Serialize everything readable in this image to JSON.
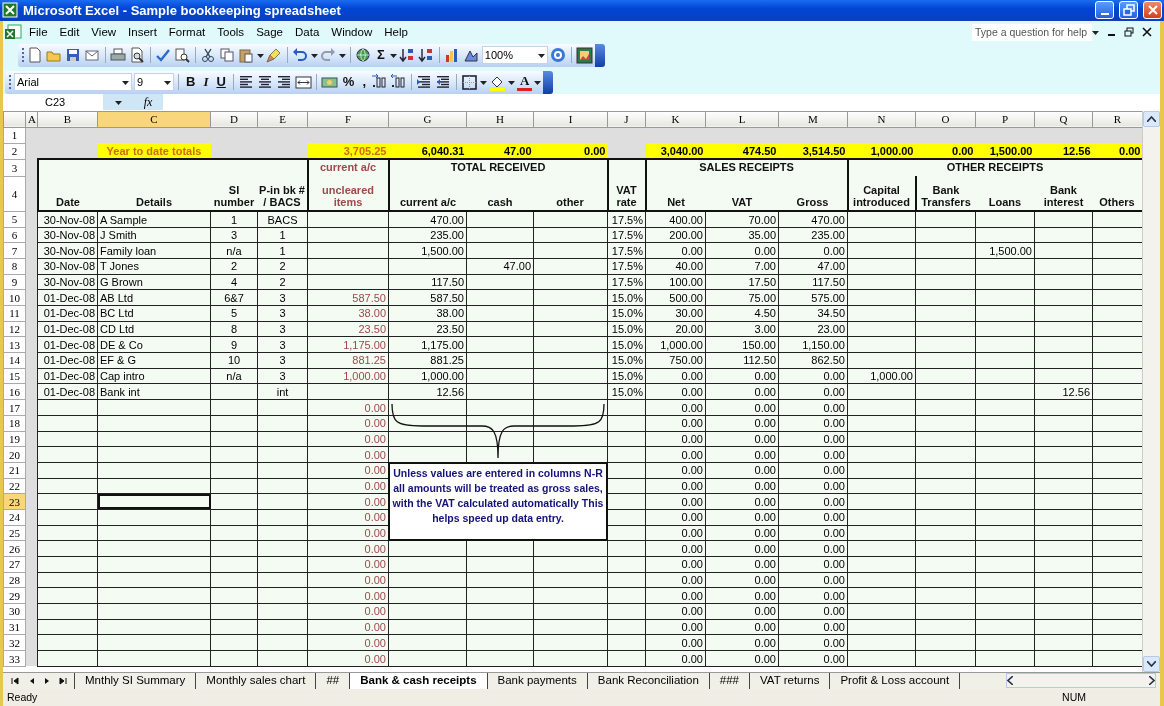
{
  "window": {
    "title": "Microsoft Excel - Sample bookkeeping spreadsheet"
  },
  "menu": [
    "File",
    "Edit",
    "View",
    "Insert",
    "Format",
    "Tools",
    "Sage",
    "Data",
    "Window",
    "Help"
  ],
  "help_search": {
    "placeholder": "Type a question for help"
  },
  "standard_toolbar": {
    "autosum": "Σ",
    "zoom": "100%"
  },
  "formatting_toolbar": {
    "font": "Arial",
    "size": "9",
    "bold": "B",
    "italic": "I",
    "underline": "U",
    "percent": "%",
    "comma": ",",
    "font_color": "A"
  },
  "formula_bar": {
    "name_box": "C23",
    "function_label": "fx"
  },
  "columns": [
    {
      "letter": "A",
      "selected": false
    },
    {
      "letter": "B",
      "selected": false
    },
    {
      "letter": "C",
      "selected": true
    },
    {
      "letter": "D",
      "selected": false
    },
    {
      "letter": "E",
      "selected": false
    },
    {
      "letter": "F",
      "selected": false
    },
    {
      "letter": "G",
      "selected": false
    },
    {
      "letter": "H",
      "selected": false
    },
    {
      "letter": "I",
      "selected": false
    },
    {
      "letter": "J",
      "selected": false
    },
    {
      "letter": "K",
      "selected": false
    },
    {
      "letter": "L",
      "selected": false
    },
    {
      "letter": "M",
      "selected": false
    },
    {
      "letter": "N",
      "selected": false
    },
    {
      "letter": "O",
      "selected": false
    },
    {
      "letter": "P",
      "selected": false
    },
    {
      "letter": "Q",
      "selected": false
    },
    {
      "letter": "R",
      "selected": false
    }
  ],
  "rows": [
    {
      "number": "1",
      "kind": "spacer",
      "selected": false,
      "cells": []
    },
    {
      "number": "2",
      "kind": "totals",
      "selected": false,
      "cells": [
        null,
        null,
        "Year to date totals",
        null,
        null,
        "3,705.25",
        "6,040.31",
        "47.00",
        "0.00",
        null,
        "3,040.00",
        "474.50",
        "3,514.50",
        "1,000.00",
        "0.00",
        "1,500.00",
        "12.56",
        "0.00"
      ]
    },
    {
      "number": "3",
      "kind": "group_header",
      "selected": false,
      "cells": [
        null,
        null,
        null,
        null,
        null,
        "current a/c",
        "TOTAL RECEIVED",
        null,
        null,
        null,
        "SALES RECEIPTS",
        null,
        null,
        "OTHER RECEIPTS",
        null,
        null,
        null,
        null
      ]
    },
    {
      "number": "4",
      "kind": "column_header",
      "selected": false,
      "cells": [
        null,
        "Date",
        "Details",
        "SI number",
        "P-in bk # / BACS",
        "uncleared items",
        "current a/c",
        "cash",
        "other",
        "VAT rate",
        "Net",
        "VAT",
        "Gross",
        "Capital introduced",
        "Bank Transfers",
        "Loans",
        "Bank interest",
        "Others"
      ]
    },
    {
      "number": "5",
      "kind": "data",
      "selected": false,
      "cells": [
        null,
        "30-Nov-08",
        "A Sample",
        "1",
        "BACS",
        null,
        "470.00",
        null,
        null,
        "17.5%",
        "400.00",
        "70.00",
        "470.00",
        null,
        null,
        null,
        null,
        null
      ]
    },
    {
      "number": "6",
      "kind": "data",
      "selected": false,
      "cells": [
        null,
        "30-Nov-08",
        "J Smith",
        "3",
        "1",
        null,
        "235.00",
        null,
        null,
        "17.5%",
        "200.00",
        "35.00",
        "235.00",
        null,
        null,
        null,
        null,
        null
      ]
    },
    {
      "number": "7",
      "kind": "data",
      "selected": false,
      "cells": [
        null,
        "30-Nov-08",
        "Family loan",
        "n/a",
        "1",
        null,
        "1,500.00",
        null,
        null,
        "17.5%",
        "0.00",
        "0.00",
        "0.00",
        null,
        null,
        "1,500.00",
        null,
        null
      ]
    },
    {
      "number": "8",
      "kind": "data",
      "selected": false,
      "cells": [
        null,
        "30-Nov-08",
        "T Jones",
        "2",
        "2",
        null,
        null,
        "47.00",
        null,
        "17.5%",
        "40.00",
        "7.00",
        "47.00",
        null,
        null,
        null,
        null,
        null
      ]
    },
    {
      "number": "9",
      "kind": "data",
      "selected": false,
      "cells": [
        null,
        "30-Nov-08",
        "G Brown",
        "4",
        "2",
        null,
        "117.50",
        null,
        null,
        "17.5%",
        "100.00",
        "17.50",
        "117.50",
        null,
        null,
        null,
        null,
        null
      ]
    },
    {
      "number": "10",
      "kind": "data",
      "selected": false,
      "cells": [
        null,
        "01-Dec-08",
        "AB Ltd",
        "6&7",
        "3",
        "587.50",
        "587.50",
        null,
        null,
        "15.0%",
        "500.00",
        "75.00",
        "575.00",
        null,
        null,
        null,
        null,
        null
      ]
    },
    {
      "number": "11",
      "kind": "data",
      "selected": false,
      "cells": [
        null,
        "01-Dec-08",
        "BC Ltd",
        "5",
        "3",
        "38.00",
        "38.00",
        null,
        null,
        "15.0%",
        "30.00",
        "4.50",
        "34.50",
        null,
        null,
        null,
        null,
        null
      ]
    },
    {
      "number": "12",
      "kind": "data",
      "selected": false,
      "cells": [
        null,
        "01-Dec-08",
        "CD Ltd",
        "8",
        "3",
        "23.50",
        "23.50",
        null,
        null,
        "15.0%",
        "20.00",
        "3.00",
        "23.00",
        null,
        null,
        null,
        null,
        null
      ]
    },
    {
      "number": "13",
      "kind": "data",
      "selected": false,
      "cells": [
        null,
        "01-Dec-08",
        "DE & Co",
        "9",
        "3",
        "1,175.00",
        "1,175.00",
        null,
        null,
        "15.0%",
        "1,000.00",
        "150.00",
        "1,150.00",
        null,
        null,
        null,
        null,
        null
      ]
    },
    {
      "number": "14",
      "kind": "data",
      "selected": false,
      "cells": [
        null,
        "01-Dec-08",
        "EF & G",
        "10",
        "3",
        "881.25",
        "881.25",
        null,
        null,
        "15.0%",
        "750.00",
        "112.50",
        "862.50",
        null,
        null,
        null,
        null,
        null
      ]
    },
    {
      "number": "15",
      "kind": "data",
      "selected": false,
      "cells": [
        null,
        "01-Dec-08",
        "Cap intro",
        "n/a",
        "3",
        "1,000.00",
        "1,000.00",
        null,
        null,
        "15.0%",
        "0.00",
        "0.00",
        "0.00",
        "1,000.00",
        null,
        null,
        null,
        null
      ]
    },
    {
      "number": "16",
      "kind": "data",
      "selected": false,
      "cells": [
        null,
        "01-Dec-08",
        "Bank int",
        null,
        "int",
        null,
        "12.56",
        null,
        null,
        "15.0%",
        "0.00",
        "0.00",
        "0.00",
        null,
        null,
        null,
        "12.56",
        null
      ]
    },
    {
      "number": "17",
      "kind": "data",
      "selected": false,
      "cells": [
        null,
        null,
        null,
        null,
        null,
        "0.00",
        null,
        null,
        null,
        null,
        "0.00",
        "0.00",
        "0.00",
        null,
        null,
        null,
        null,
        null
      ]
    },
    {
      "number": "18",
      "kind": "data",
      "selected": false,
      "cells": [
        null,
        null,
        null,
        null,
        null,
        "0.00",
        null,
        null,
        null,
        null,
        "0.00",
        "0.00",
        "0.00",
        null,
        null,
        null,
        null,
        null
      ]
    },
    {
      "number": "19",
      "kind": "data",
      "selected": false,
      "cells": [
        null,
        null,
        null,
        null,
        null,
        "0.00",
        null,
        null,
        null,
        null,
        "0.00",
        "0.00",
        "0.00",
        null,
        null,
        null,
        null,
        null
      ]
    },
    {
      "number": "20",
      "kind": "data",
      "selected": false,
      "cells": [
        null,
        null,
        null,
        null,
        null,
        "0.00",
        null,
        null,
        null,
        null,
        "0.00",
        "0.00",
        "0.00",
        null,
        null,
        null,
        null,
        null
      ]
    },
    {
      "number": "21",
      "kind": "data",
      "selected": false,
      "cells": [
        null,
        null,
        null,
        null,
        null,
        "0.00",
        null,
        null,
        null,
        null,
        "0.00",
        "0.00",
        "0.00",
        null,
        null,
        null,
        null,
        null
      ]
    },
    {
      "number": "22",
      "kind": "data",
      "selected": false,
      "cells": [
        null,
        null,
        null,
        null,
        null,
        "0.00",
        null,
        null,
        null,
        null,
        "0.00",
        "0.00",
        "0.00",
        null,
        null,
        null,
        null,
        null
      ]
    },
    {
      "number": "23",
      "kind": "data",
      "selected": true,
      "cells": [
        null,
        null,
        null,
        null,
        null,
        "0.00",
        null,
        null,
        null,
        null,
        "0.00",
        "0.00",
        "0.00",
        null,
        null,
        null,
        null,
        null
      ]
    },
    {
      "number": "24",
      "kind": "data",
      "selected": false,
      "cells": [
        null,
        null,
        null,
        null,
        null,
        "0.00",
        null,
        null,
        null,
        null,
        "0.00",
        "0.00",
        "0.00",
        null,
        null,
        null,
        null,
        null
      ]
    },
    {
      "number": "25",
      "kind": "data",
      "selected": false,
      "cells": [
        null,
        null,
        null,
        null,
        null,
        "0.00",
        null,
        null,
        null,
        null,
        "0.00",
        "0.00",
        "0.00",
        null,
        null,
        null,
        null,
        null
      ]
    },
    {
      "number": "26",
      "kind": "data",
      "selected": false,
      "cells": [
        null,
        null,
        null,
        null,
        null,
        "0.00",
        null,
        null,
        null,
        null,
        "0.00",
        "0.00",
        "0.00",
        null,
        null,
        null,
        null,
        null
      ]
    },
    {
      "number": "27",
      "kind": "data",
      "selected": false,
      "cells": [
        null,
        null,
        null,
        null,
        null,
        "0.00",
        null,
        null,
        null,
        null,
        "0.00",
        "0.00",
        "0.00",
        null,
        null,
        null,
        null,
        null
      ]
    },
    {
      "number": "28",
      "kind": "data",
      "selected": false,
      "cells": [
        null,
        null,
        null,
        null,
        null,
        "0.00",
        null,
        null,
        null,
        null,
        "0.00",
        "0.00",
        "0.00",
        null,
        null,
        null,
        null,
        null
      ]
    },
    {
      "number": "29",
      "kind": "data",
      "selected": false,
      "cells": [
        null,
        null,
        null,
        null,
        null,
        "0.00",
        null,
        null,
        null,
        null,
        "0.00",
        "0.00",
        "0.00",
        null,
        null,
        null,
        null,
        null
      ]
    },
    {
      "number": "30",
      "kind": "data",
      "selected": false,
      "cells": [
        null,
        null,
        null,
        null,
        null,
        "0.00",
        null,
        null,
        null,
        null,
        "0.00",
        "0.00",
        "0.00",
        null,
        null,
        null,
        null,
        null
      ]
    },
    {
      "number": "31",
      "kind": "data",
      "selected": false,
      "cells": [
        null,
        null,
        null,
        null,
        null,
        "0.00",
        null,
        null,
        null,
        null,
        "0.00",
        "0.00",
        "0.00",
        null,
        null,
        null,
        null,
        null
      ]
    },
    {
      "number": "32",
      "kind": "data",
      "selected": false,
      "cells": [
        null,
        null,
        null,
        null,
        null,
        "0.00",
        null,
        null,
        null,
        null,
        "0.00",
        "0.00",
        "0.00",
        null,
        null,
        null,
        null,
        null
      ]
    },
    {
      "number": "33",
      "kind": "data",
      "selected": false,
      "cells": [
        null,
        null,
        null,
        null,
        null,
        "0.00",
        null,
        null,
        null,
        null,
        "0.00",
        "0.00",
        "0.00",
        null,
        null,
        null,
        null,
        null
      ]
    }
  ],
  "note": {
    "text": "Unless values are entered in columns N-R all amounts will be treated as gross sales, with the VAT calculated automatically This helps speed up data entry."
  },
  "sheet_tabs": [
    {
      "label": "Mnthly SI Summary",
      "selected": false
    },
    {
      "label": "Monthly sales chart",
      "selected": false
    },
    {
      "label": "##",
      "selected": false
    },
    {
      "label": "Bank & cash receipts",
      "selected": true
    },
    {
      "label": "Bank payments",
      "selected": false
    },
    {
      "label": "Bank Reconciliation",
      "selected": false
    },
    {
      "label": "###",
      "selected": false
    },
    {
      "label": "VAT returns",
      "selected": false
    },
    {
      "label": "Profit & Loss account",
      "selected": false
    }
  ],
  "status_bar": {
    "left": "Ready",
    "right": "NUM"
  }
}
